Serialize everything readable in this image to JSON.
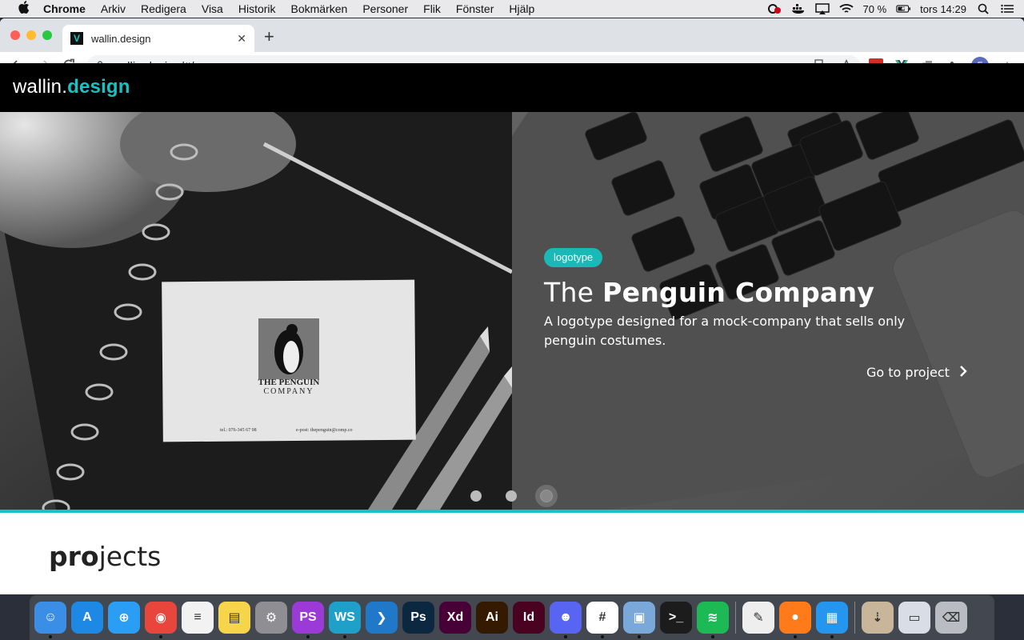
{
  "menubar": {
    "apple": "",
    "app": "Chrome",
    "items": [
      "Arkiv",
      "Redigera",
      "Visa",
      "Historik",
      "Bokmärken",
      "Personer",
      "Flik",
      "Fönster",
      "Hjälp"
    ],
    "battery": "70 %",
    "clock": "tors 14:29"
  },
  "browser": {
    "tab_title": "wallin.design",
    "tab_close": "✕",
    "new_tab": "+",
    "url": "wallin.design/#/",
    "avatar_letter": "F"
  },
  "site": {
    "logo_main": "wallin.",
    "logo_accent": "design",
    "slide": {
      "badge": "logotype",
      "title_light": "The ",
      "title_bold": "Penguin Company",
      "description": "A logotype designed for a mock-company that sells only penguin costumes.",
      "link": "Go to project",
      "card_line1": "THE PENGUIN",
      "card_line2": "COMPANY",
      "card_tel": "tel.: 076-345 67 98",
      "card_email": "e-post: thepenguin@comp.co"
    },
    "carousel": {
      "count": 3,
      "active_index": 2
    },
    "projects_bold": "pro",
    "projects_rest": "jects"
  },
  "colors": {
    "accent": "#18c2c2",
    "header_bg": "#000000"
  },
  "dock": {
    "apps": [
      {
        "name": "Finder",
        "label": "☺",
        "color": "#3a8ee6",
        "running": true
      },
      {
        "name": "App Store",
        "label": "A",
        "color": "#1e88e5",
        "running": false
      },
      {
        "name": "Safari",
        "label": "⊕",
        "color": "#2a9df4",
        "running": false
      },
      {
        "name": "Chrome",
        "label": "◉",
        "color": "#e8453c",
        "running": true
      },
      {
        "name": "Reminders",
        "label": "≡",
        "color": "#f2f2f2",
        "running": false
      },
      {
        "name": "Notes",
        "label": "▤",
        "color": "#f7d54a",
        "running": false
      },
      {
        "name": "System Preferences",
        "label": "⚙",
        "color": "#8e8e93",
        "running": false
      },
      {
        "name": "PhpStorm",
        "label": "PS",
        "color": "#9b3ad6",
        "running": true
      },
      {
        "name": "WebStorm",
        "label": "WS",
        "color": "#1fa0c8",
        "running": true
      },
      {
        "name": "VS Code",
        "label": "❯",
        "color": "#1f78c8",
        "running": false
      },
      {
        "name": "Photoshop",
        "label": "Ps",
        "color": "#0c2740",
        "running": false
      },
      {
        "name": "Adobe XD",
        "label": "Xd",
        "color": "#470137",
        "running": false
      },
      {
        "name": "Illustrator",
        "label": "Ai",
        "color": "#331a00",
        "running": false
      },
      {
        "name": "InDesign",
        "label": "Id",
        "color": "#49021f",
        "running": false
      },
      {
        "name": "Discord",
        "label": "☻",
        "color": "#5865f2",
        "running": true
      },
      {
        "name": "Slack",
        "label": "#",
        "color": "#ffffff",
        "running": true
      },
      {
        "name": "Preview",
        "label": "▣",
        "color": "#7aa8d8",
        "running": true
      },
      {
        "name": "Terminal",
        "label": ">_",
        "color": "#1c1c1c",
        "running": false
      },
      {
        "name": "Spotify",
        "label": "≋",
        "color": "#1db954",
        "running": true
      },
      {
        "name": "TextEdit",
        "label": "✎",
        "color": "#eeeeee",
        "running": false
      },
      {
        "name": "Firefox",
        "label": "●",
        "color": "#ff7a18",
        "running": true
      },
      {
        "name": "Docker",
        "label": "▦",
        "color": "#2496ed",
        "running": true
      },
      {
        "name": "Downloads",
        "label": "⇣",
        "color": "#c9b59a",
        "running": false
      },
      {
        "name": "Chrome Apps",
        "label": "▭",
        "color": "#d8dde6",
        "running": false
      },
      {
        "name": "Trash",
        "label": "⌫",
        "color": "#b9bcc2",
        "running": false
      }
    ]
  }
}
